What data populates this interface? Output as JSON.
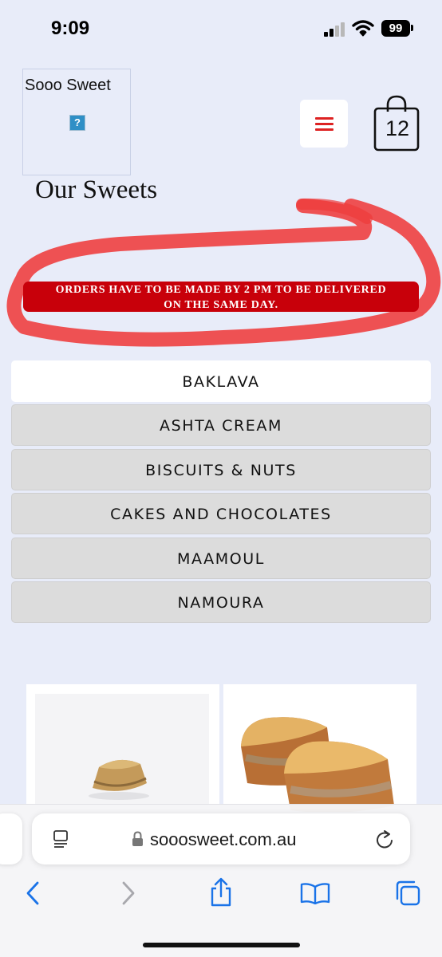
{
  "status_bar": {
    "time": "9:09",
    "battery": "99"
  },
  "header": {
    "logo_text": "Sooo Sweet",
    "broken_image_glyph": "?",
    "cart_count": "12"
  },
  "page_title": "Our Sweets",
  "notice": {
    "line1": "ORDERS HAVE TO BE MADE BY 2 PM TO BE DELIVERED",
    "line2": "ON THE SAME DAY.",
    "color": "#c8000a"
  },
  "categories": [
    {
      "label": "BAKLAVA",
      "active": true
    },
    {
      "label": "ASHTA CREAM",
      "active": false
    },
    {
      "label": "BISCUITS & NUTS",
      "active": false
    },
    {
      "label": "CAKES AND CHOCOLATES",
      "active": false
    },
    {
      "label": "MAAMOUL",
      "active": false
    },
    {
      "label": "NAMOURA",
      "active": false
    }
  ],
  "browser": {
    "url": "sooosweet.com.au",
    "icons": [
      "reader-icon",
      "lock-icon",
      "reload-icon",
      "back-icon",
      "forward-icon",
      "share-icon",
      "bookmarks-icon",
      "tabs-icon"
    ]
  },
  "colors": {
    "accent": "#d22222",
    "background": "#e8ecf9",
    "link_blue": "#1a73e8"
  }
}
